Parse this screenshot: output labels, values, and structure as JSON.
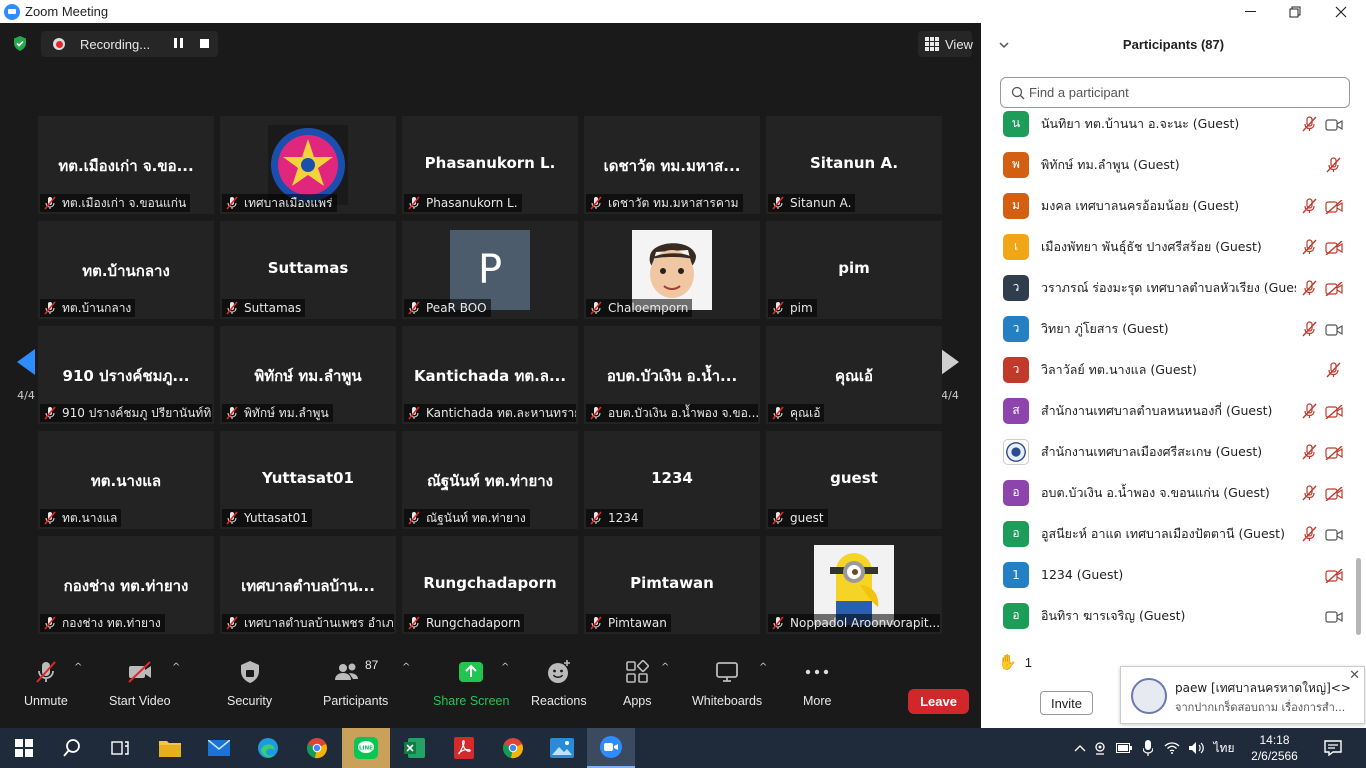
{
  "window": {
    "title": "Zoom Meeting",
    "minimize": "—",
    "restore": "❐",
    "close": "✕"
  },
  "topbar": {
    "recording_label": "Recording...",
    "view_label": "View"
  },
  "gallery": {
    "page_left": "4/4",
    "page_right": "4/4",
    "tiles": [
      {
        "big": "ทต.เมืองเก่า จ.ขอ...",
        "label": "ทต.เมืองเก่า จ.ขอนแก่น"
      },
      {
        "big": "",
        "label": "เทศบาลเมืองแพร่",
        "image": "municipal-emblem"
      },
      {
        "big": "Phasanukorn L.",
        "label": "Phasanukorn L."
      },
      {
        "big": "เดชาวัต ทม.มหาส...",
        "label": "เดชาวัต ทม.มหาสารคาม"
      },
      {
        "big": "Sitanun A.",
        "label": "Sitanun A."
      },
      {
        "big": "ทต.บ้านกลาง",
        "label": "ทต.บ้านกลาง"
      },
      {
        "big": "Suttamas",
        "label": "Suttamas"
      },
      {
        "big": "",
        "label": "PeaR BOO",
        "initial": "P"
      },
      {
        "big": "",
        "label": "Chaloemporn",
        "image": "cartoon-face"
      },
      {
        "big": "pim",
        "label": "pim"
      },
      {
        "big": "910 ปรางค์ชมภู...",
        "label": "910 ปรางค์ชมภู ปรียานันท์ทิ..."
      },
      {
        "big": "พิทักษ์ ทม.ลำพูน",
        "label": "พิทักษ์ ทม.ลำพูน"
      },
      {
        "big": "Kantichada ทต.ล...",
        "label": "Kantichada ทต.ละหานทราย"
      },
      {
        "big": "อบต.บัวเงิน อ.น้ำ...",
        "label": "อบต.บัวเงิน อ.น้ำพอง จ.ขอ..."
      },
      {
        "big": "คุณเอ้",
        "label": "คุณเอ้"
      },
      {
        "big": "ทต.นางแล",
        "label": "ทต.นางแล"
      },
      {
        "big": "Yuttasat01",
        "label": "Yuttasat01"
      },
      {
        "big": "ณัฐนันท์ ทต.ท่ายาง",
        "label": "ณัฐนันท์ ทต.ท่ายาง"
      },
      {
        "big": "1234",
        "label": "1234"
      },
      {
        "big": "guest",
        "label": "guest"
      },
      {
        "big": "กองช่าง ทต.ท่ายาง",
        "label": "กองช่าง ทต.ท่ายาง"
      },
      {
        "big": "เทศบาลตำบลบ้าน...",
        "label": "เทศบาลตำบลบ้านเพชร อำเภ..."
      },
      {
        "big": "Rungchadaporn",
        "label": "Rungchadaporn"
      },
      {
        "big": "Pimtawan",
        "label": "Pimtawan"
      },
      {
        "big": "",
        "label": "Noppadol Aroonvorapit...",
        "image": "minion"
      }
    ]
  },
  "toolbar": {
    "unmute": "Unmute",
    "start_video": "Start Video",
    "security": "Security",
    "participants": "Participants",
    "participants_count": "87",
    "share_screen": "Share Screen",
    "reactions": "Reactions",
    "apps": "Apps",
    "whiteboards": "Whiteboards",
    "more": "More",
    "leave": "Leave"
  },
  "panel": {
    "title": "Participants (87)",
    "search_placeholder": "Find a participant",
    "participants": [
      {
        "initial": "น",
        "color": "#1e9c5a",
        "name": "นันทิยา ทต.บ้านนา อ.จะนะ (Guest)",
        "cam": "on"
      },
      {
        "initial": "พ",
        "color": "#d35f12",
        "name": "พิทักษ์ ทม.ลำพูน (Guest)",
        "cam": "none"
      },
      {
        "initial": "ม",
        "color": "#d35f12",
        "name": "มงคล เทศบาลนครอ้อมน้อย (Guest)",
        "cam": "off"
      },
      {
        "initial": "เ",
        "color": "#f0a716",
        "name": "เมืองพัทยา  พันธุ์ธัช ปางศรีสร้อย (Guest)",
        "cam": "off"
      },
      {
        "initial": "ว",
        "color": "#2f3d4d",
        "name": "วราภรณ์   ร่องมะรุด เทศบาลตำบลหัวเรียง (Guest)",
        "cam": "off"
      },
      {
        "initial": "ว",
        "color": "#2480c2",
        "name": "วิทยา ภู่โยสาร (Guest)",
        "cam": "on"
      },
      {
        "initial": "ว",
        "color": "#c0392b",
        "name": "วิลาวัลย์ ทต.นางแล (Guest)",
        "cam": "none"
      },
      {
        "initial": "ส",
        "color": "#8e44ad",
        "name": "สำนักงานเทศบาลตำบลหนหนองกี่ (Guest)",
        "cam": "off"
      },
      {
        "initial": "",
        "color": "#ffffff",
        "name": "สำนักงานเทศบาลเมืองศรีสะเกษ (Guest)",
        "cam": "off",
        "image": "emblem"
      },
      {
        "initial": "อ",
        "color": "#8e44ad",
        "name": "อบต.บัวเงิน อ.น้ำพอง จ.ขอนแก่น (Guest)",
        "cam": "off"
      },
      {
        "initial": "อ",
        "color": "#1e9c5a",
        "name": "อูสนียะห์ อาแด เทศบาลเมืองปัตตานี (Guest)",
        "cam": "on"
      },
      {
        "initial": "1",
        "color": "#2480c2",
        "name": "1234 (Guest)",
        "cam": "off",
        "no_mic": true
      },
      {
        "initial": "อ",
        "color": "#1e9c5a",
        "name": "อินทิรา ฆารเจริญ (Guest)",
        "cam": "on",
        "no_mic": true
      }
    ],
    "raised_hands": "1",
    "invite": "Invite",
    "notification": {
      "line1": "paew [เทศบาลนครหาดใหญ่]<>A...",
      "line2": "จากปากเกร็ดสอบถาม เรื่องการสำ...",
      "close": "✕"
    }
  },
  "taskbar": {
    "time": "14:18",
    "date": "2/6/2566",
    "lang": "ไทย"
  }
}
